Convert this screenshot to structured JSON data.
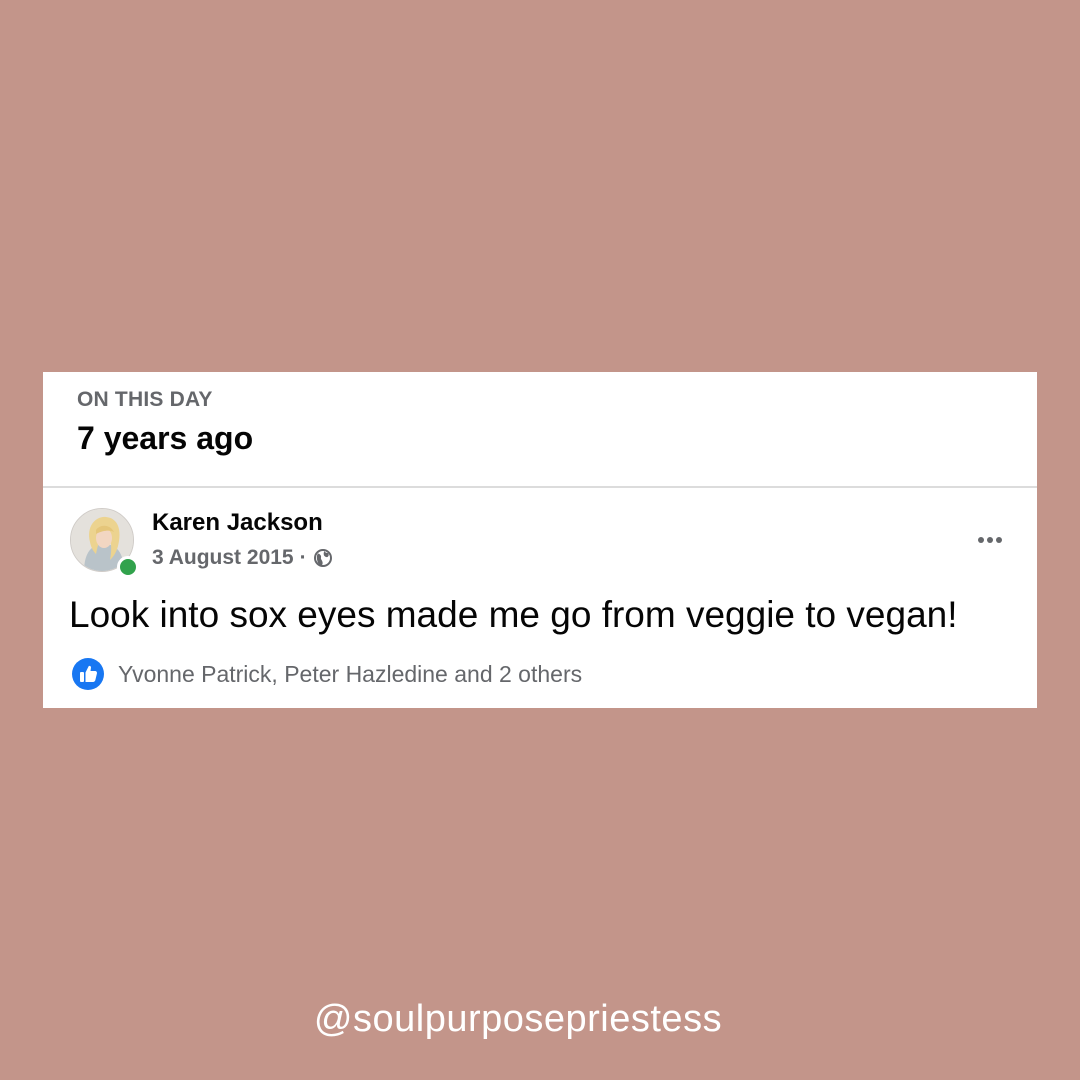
{
  "memory": {
    "section_label": "ON THIS DAY",
    "title": "7 years ago"
  },
  "post": {
    "author": "Karen Jackson",
    "date": "3 August 2015",
    "separator": "·",
    "privacy_icon": "globe-icon",
    "online": true,
    "text": "Look into sox eyes made me go from veggie to vegan!",
    "reaction_icon": "like-icon",
    "reactions_summary": "Yvonne Patrick, Peter Hazledine and 2 others"
  },
  "footer": {
    "handle": "@soulpurposepriestess"
  },
  "colors": {
    "background": "#c3958a",
    "card": "#ffffff",
    "secondary_text": "#65676b",
    "online_dot": "#31a24c",
    "like_blue": "#1877f2"
  }
}
